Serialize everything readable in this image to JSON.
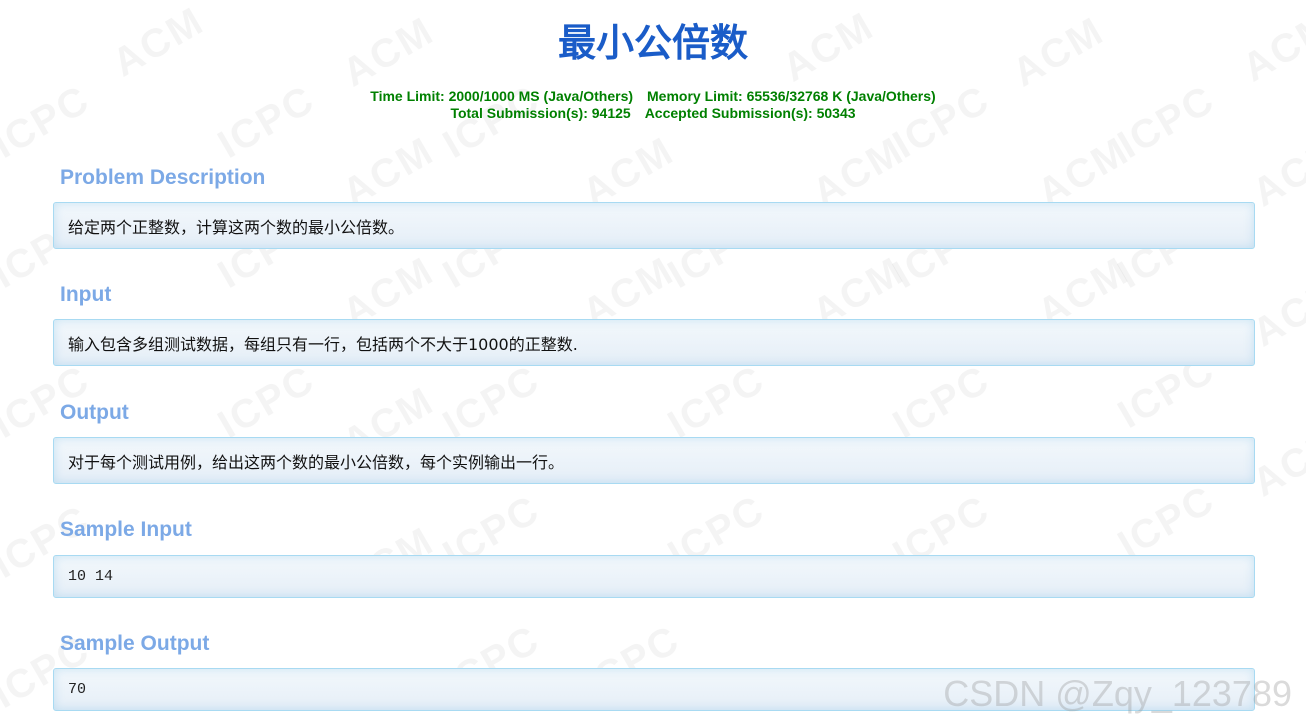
{
  "problem": {
    "title": "最小公倍数",
    "limits": {
      "time": "Time Limit: 2000/1000 MS (Java/Others)",
      "memory": "Memory Limit: 65536/32768 K (Java/Others)",
      "total": "Total Submission(s): 94125",
      "accepted": "Accepted Submission(s): 50343"
    }
  },
  "sections": {
    "description": {
      "heading": "Problem Description",
      "body": "给定两个正整数，计算这两个数的最小公倍数。"
    },
    "input": {
      "heading": "Input",
      "body": "输入包含多组测试数据，每组只有一行，包括两个不大于1000的正整数."
    },
    "output": {
      "heading": "Output",
      "body": "对于每个测试用例，给出这两个数的最小公倍数，每个实例输出一行。"
    },
    "sample_input": {
      "heading": "Sample Input",
      "body": "10 14"
    },
    "sample_output": {
      "heading": "Sample Output",
      "body": "70"
    }
  },
  "watermark": {
    "text_a": "ACM",
    "text_b": "ICPC",
    "corner": "CSDN @Zqy_123789"
  },
  "colors": {
    "title": "#1a5cc8",
    "limits": "#008000",
    "section_heading": "#7ca9e6",
    "panel_border": "#a8daf2"
  }
}
